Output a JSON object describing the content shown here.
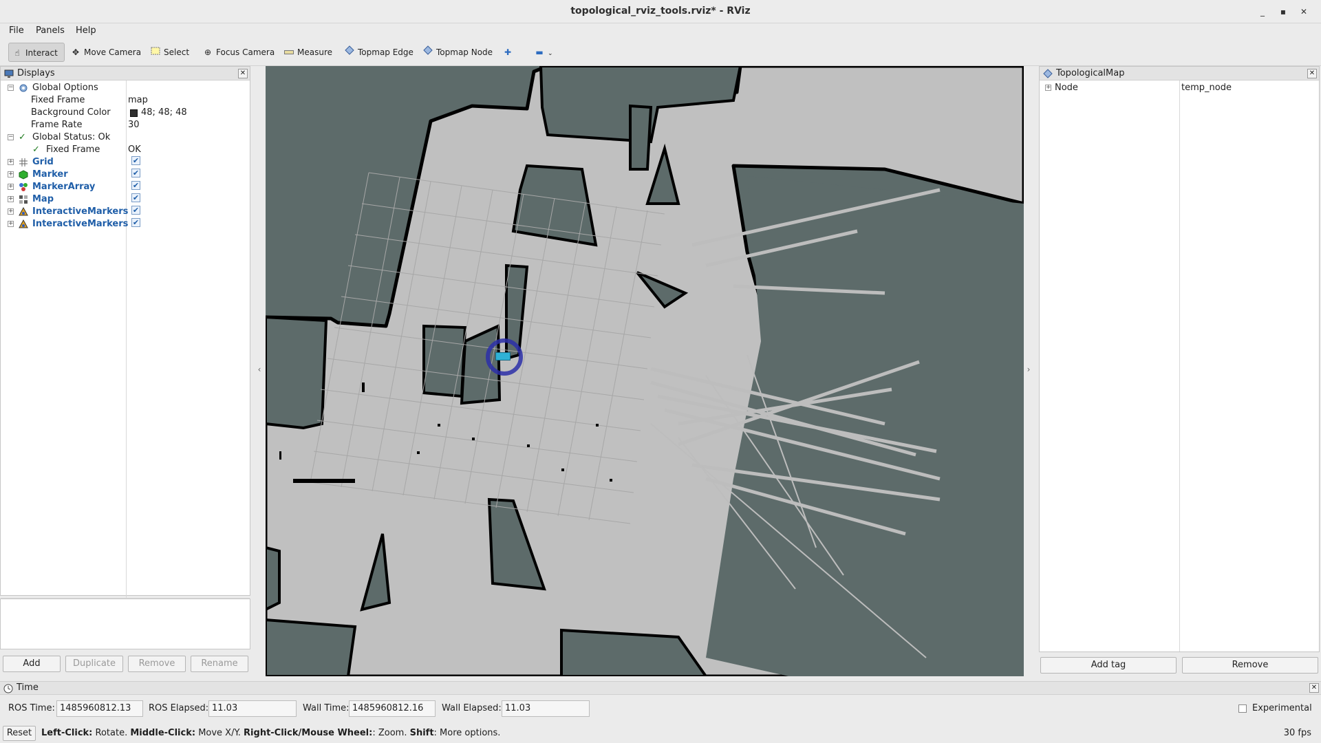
{
  "window": {
    "title": "topological_rviz_tools.rviz* - RViz"
  },
  "menu": [
    "File",
    "Panels",
    "Help"
  ],
  "toolbar": {
    "interact": "Interact",
    "move_camera": "Move Camera",
    "select": "Select",
    "focus_camera": "Focus Camera",
    "measure": "Measure",
    "topmap_edge": "Topmap Edge",
    "topmap_node": "Topmap Node"
  },
  "displays": {
    "title": "Displays",
    "global_options": {
      "label": "Global Options",
      "fixed_frame_label": "Fixed Frame",
      "fixed_frame_value": "map",
      "background_label": "Background Color",
      "background_value": "48; 48; 48",
      "background_color": "#303030",
      "frame_rate_label": "Frame Rate",
      "frame_rate_value": "30"
    },
    "global_status": {
      "label": "Global Status: Ok",
      "fixed_frame_label": "Fixed Frame",
      "fixed_frame_value": "OK"
    },
    "items": [
      {
        "label": "Grid",
        "icon": "grid-icon",
        "checked": true
      },
      {
        "label": "Marker",
        "icon": "marker-icon",
        "checked": true
      },
      {
        "label": "MarkerArray",
        "icon": "marker-array-icon",
        "checked": true
      },
      {
        "label": "Map",
        "icon": "map-icon",
        "checked": true
      },
      {
        "label": "InteractiveMarkers",
        "icon": "interactive-markers-icon",
        "checked": true
      },
      {
        "label": "InteractiveMarkers",
        "icon": "interactive-markers-icon",
        "checked": true
      }
    ],
    "buttons": {
      "add": "Add",
      "duplicate": "Duplicate",
      "remove": "Remove",
      "rename": "Rename"
    }
  },
  "topological_map": {
    "title": "TopologicalMap",
    "node_label": "Node",
    "node_value": "temp_node",
    "add_tag": "Add tag",
    "remove": "Remove"
  },
  "time": {
    "title": "Time",
    "ros_time_label": "ROS Time:",
    "ros_time": "1485960812.13",
    "ros_elapsed_label": "ROS Elapsed:",
    "ros_elapsed": "11.03",
    "wall_time_label": "Wall Time:",
    "wall_time": "1485960812.16",
    "wall_elapsed_label": "Wall Elapsed:",
    "wall_elapsed": "11.03",
    "experimental": "Experimental"
  },
  "status": {
    "reset": "Reset",
    "hint_left_click": "Left-Click:",
    "hint_rotate": "Rotate.",
    "hint_middle_click": "Middle-Click:",
    "hint_move": "Move X/Y.",
    "hint_right_click": "Right-Click/Mouse Wheel:",
    "hint_zoom": ": Zoom.",
    "hint_shift": "Shift",
    "hint_more": ": More options.",
    "fps": "30 fps"
  },
  "colors": {
    "accent": "#1f5ea8",
    "map_unknown": "#5d6b6a",
    "map_free": "#c0c0c0",
    "map_occupied": "#000000",
    "marker_ring": "#2b2fa8",
    "marker_fill": "#2fb2d6"
  }
}
